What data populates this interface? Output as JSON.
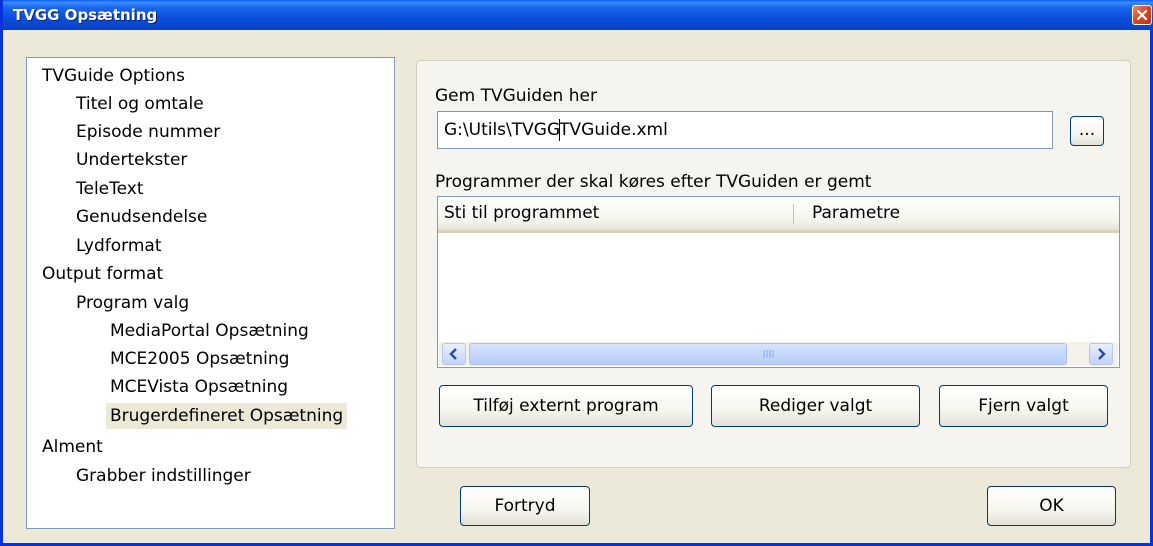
{
  "window": {
    "title": "TVGG Opsætning"
  },
  "tree": {
    "items": [
      {
        "label": "TVGuide Options",
        "level": 0
      },
      {
        "label": "Titel og omtale",
        "level": 1
      },
      {
        "label": "Episode nummer",
        "level": 1
      },
      {
        "label": "Undertekster",
        "level": 1
      },
      {
        "label": "TeleText",
        "level": 1
      },
      {
        "label": "Genudsendelse",
        "level": 1
      },
      {
        "label": "Lydformat",
        "level": 1
      },
      {
        "label": "Output format",
        "level": 0
      },
      {
        "label": "Program valg",
        "level": 1
      },
      {
        "label": "MediaPortal Opsætning",
        "level": 2
      },
      {
        "label": "MCE2005 Opsætning",
        "level": 2
      },
      {
        "label": "MCEVista Opsætning",
        "level": 2
      },
      {
        "label": "Brugerdefineret Opsætning",
        "level": 2,
        "selected": true
      },
      {
        "label": "Alment",
        "level": 0
      },
      {
        "label": "Grabber indstillinger",
        "level": 1
      }
    ]
  },
  "settings": {
    "save_label": "Gem TVGuiden her",
    "path_before_caret": "G:\\Utils\\TVGG",
    "path_after_caret": "TVGuide.xml",
    "browse_label": "...",
    "programs_label": "Programmer der skal køres efter TVGuiden er gemt",
    "columns": [
      "Sti til programmet",
      "Parametre"
    ],
    "add_button": "Tilføj externt program",
    "edit_button": "Rediger valgt",
    "remove_button": "Fjern valgt"
  },
  "footer": {
    "cancel_button": "Fortryd",
    "ok_button": "OK"
  }
}
